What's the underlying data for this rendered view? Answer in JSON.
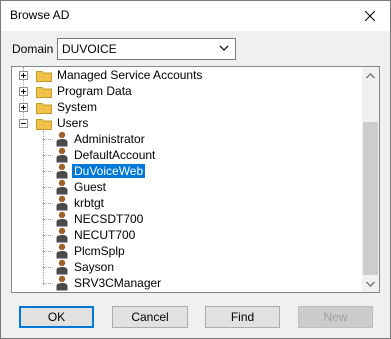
{
  "window": {
    "title": "Browse AD"
  },
  "domain": {
    "label": "Domain",
    "value": "DUVOICE"
  },
  "tree": {
    "containers": [
      {
        "label": "Managed Service Accounts",
        "expanded": false
      },
      {
        "label": "Program Data",
        "expanded": false
      },
      {
        "label": "System",
        "expanded": false
      },
      {
        "label": "Users",
        "expanded": true
      }
    ],
    "users": [
      "Administrator",
      "DefaultAccount",
      "DuVoiceWeb",
      "Guest",
      "krbtgt",
      "NECSDT700",
      "NECUT700",
      "PlcmSplp",
      "Sayson",
      "SRV3CManager"
    ],
    "selected": "DuVoiceWeb"
  },
  "buttons": {
    "ok": "OK",
    "cancel": "Cancel",
    "find": "Find",
    "new": "New"
  },
  "colors": {
    "selection": "#0078d7",
    "folder": "#f0c24b",
    "user_head": "#a0602a",
    "user_body": "#4a4a4a"
  }
}
